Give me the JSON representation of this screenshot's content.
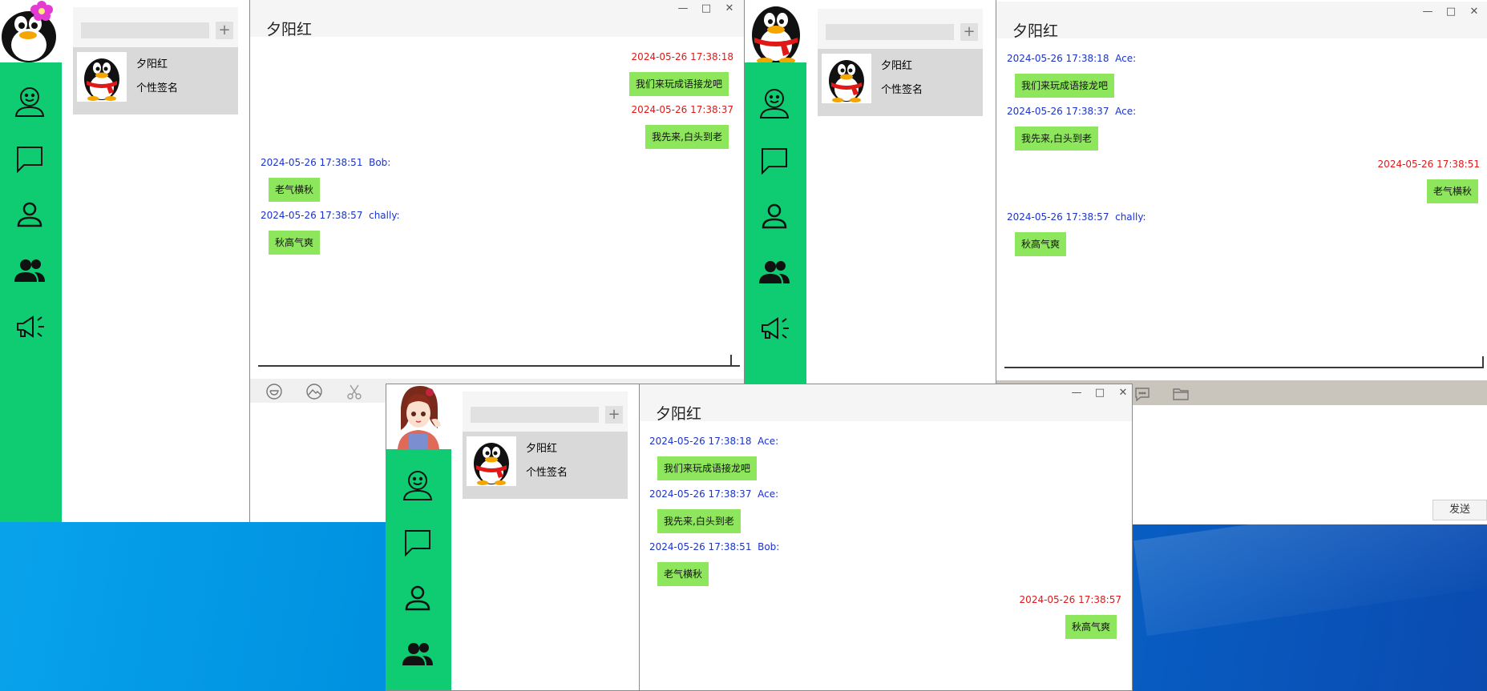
{
  "window_controls": {
    "minimize": "—",
    "maximize": "□",
    "close": "✕"
  },
  "sidebar_icons": [
    "smiley-face-icon",
    "chat-bubble-icon",
    "person-icon",
    "group-icon",
    "megaphone-icon"
  ],
  "windows": [
    {
      "id": "window-1",
      "chat_title": "夕阳红",
      "friend": {
        "name": "夕阳红",
        "signature": "个性签名"
      },
      "search": {
        "placeholder": ""
      },
      "add_label": "+",
      "messages": [
        {
          "side": "right",
          "time": "2024-05-26 17:38:18",
          "sender": "",
          "text": "我们来玩成语接龙吧"
        },
        {
          "side": "right",
          "time": "2024-05-26 17:38:37",
          "sender": "",
          "text": "我先来,白头到老"
        },
        {
          "side": "left",
          "time": "2024-05-26 17:38:51",
          "sender": "Bob:",
          "text": "老气横秋"
        },
        {
          "side": "left",
          "time": "2024-05-26 17:38:57",
          "sender": "chally:",
          "text": "秋高气爽"
        }
      ]
    },
    {
      "id": "window-2",
      "chat_title": "夕阳红",
      "friend": {
        "name": "夕阳红",
        "signature": "个性签名"
      },
      "search": {
        "placeholder": ""
      },
      "add_label": "+",
      "send_label": "发送",
      "messages": [
        {
          "side": "left",
          "time": "2024-05-26 17:38:18",
          "sender": "Ace:",
          "text": "我们来玩成语接龙吧"
        },
        {
          "side": "left",
          "time": "2024-05-26 17:38:37",
          "sender": "Ace:",
          "text": "我先来,白头到老"
        },
        {
          "side": "right",
          "time": "2024-05-26 17:38:51",
          "sender": "",
          "text": "老气横秋"
        },
        {
          "side": "left",
          "time": "2024-05-26 17:38:57",
          "sender": "chally:",
          "text": "秋高气爽"
        }
      ]
    },
    {
      "id": "window-3",
      "chat_title": "夕阳红",
      "friend": {
        "name": "夕阳红",
        "signature": "个性签名"
      },
      "search": {
        "placeholder": ""
      },
      "add_label": "+",
      "messages": [
        {
          "side": "left",
          "time": "2024-05-26 17:38:18",
          "sender": "Ace:",
          "text": "我们来玩成语接龙吧"
        },
        {
          "side": "left",
          "time": "2024-05-26 17:38:37",
          "sender": "Ace:",
          "text": "我先来,白头到老"
        },
        {
          "side": "left",
          "time": "2024-05-26 17:38:51",
          "sender": "Bob:",
          "text": "老气横秋"
        },
        {
          "side": "right",
          "time": "2024-05-26 17:38:57",
          "sender": "",
          "text": "秋高气爽"
        }
      ]
    }
  ],
  "colors": {
    "sidebar": "#0fcc72",
    "bubble": "#8ee65c",
    "self_time": "#e01818",
    "other_time": "#1a33cc"
  }
}
